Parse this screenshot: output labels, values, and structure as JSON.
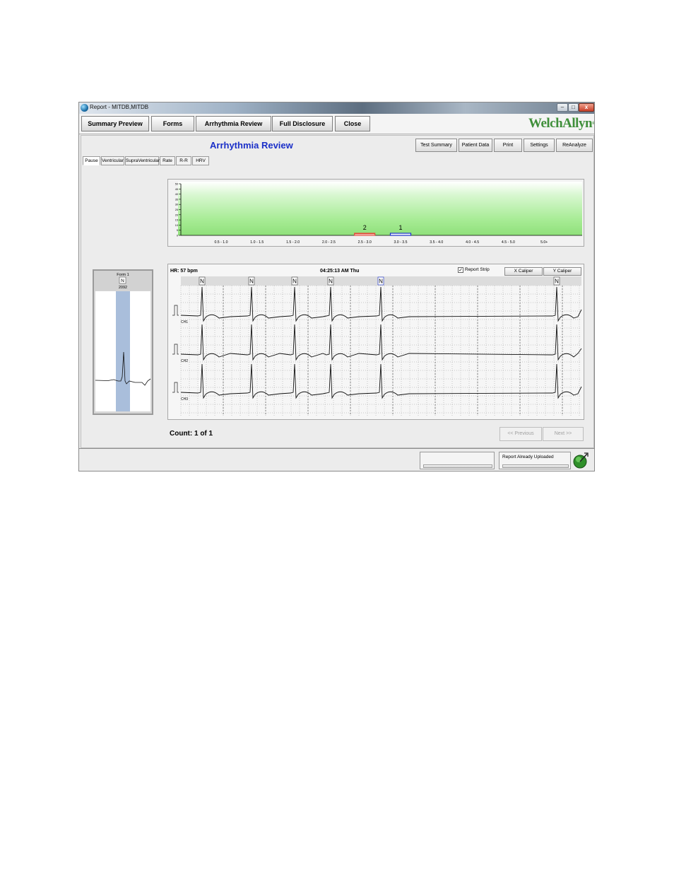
{
  "window": {
    "title": "Report - MITDB,MITDB",
    "min": "–",
    "max": "□",
    "close": "x"
  },
  "toolbar": {
    "buttons": [
      "Summary Preview",
      "Forms",
      "Arrhythmia Review",
      "Full Disclosure",
      "Close"
    ],
    "logo_left": "Welch",
    "logo_right": "Allyn",
    "logo_mark": "®"
  },
  "page": {
    "title": "Arrhythmia Review",
    "actions": [
      "Test Summary",
      "Patient Data",
      "Print",
      "Settings",
      "ReAnalyze"
    ],
    "tabs": [
      "Pause",
      "Ventricular",
      "SupraVentricular",
      "Rate",
      "R-R",
      "HRV"
    ],
    "active_tab": "Pause"
  },
  "chart_data": {
    "type": "bar",
    "categories": [
      "0.5 - 1.0",
      "1.0 - 1.5",
      "1.5 - 2.0",
      "2.0 - 2.5",
      "2.5 - 3.0",
      "3.0 - 3.5",
      "3.5 - 4.0",
      "4.0 - 4.5",
      "4.5 - 5.0",
      "5.0+"
    ],
    "values": [
      0,
      0,
      0,
      0,
      2,
      1,
      0,
      0,
      0,
      0
    ],
    "bar_colors": [
      "#e24a3a",
      "#1a2fc8"
    ],
    "yticks": [
      "50",
      "45",
      "40",
      "35",
      "30",
      "25",
      "20",
      "15",
      "10",
      "5",
      "0"
    ],
    "ylim": [
      0,
      50
    ]
  },
  "form": {
    "title": "Form 1",
    "label": "N",
    "count": "2092"
  },
  "strip": {
    "hr": "HR: 57 bpm",
    "time": "04:25:13 AM Thu",
    "report_strip_label": "Report Strip",
    "report_strip_checked": true,
    "x_caliper": "X Caliper",
    "y_caliper": "Y Caliper",
    "beat_label": "N",
    "channels": [
      "CH1",
      "CH2",
      "CH3"
    ]
  },
  "count": "Count: 1 of 1",
  "pager": {
    "previous": "<< Previous",
    "next": "Next >>"
  },
  "status": {
    "message": "Report Already Uploaded"
  }
}
